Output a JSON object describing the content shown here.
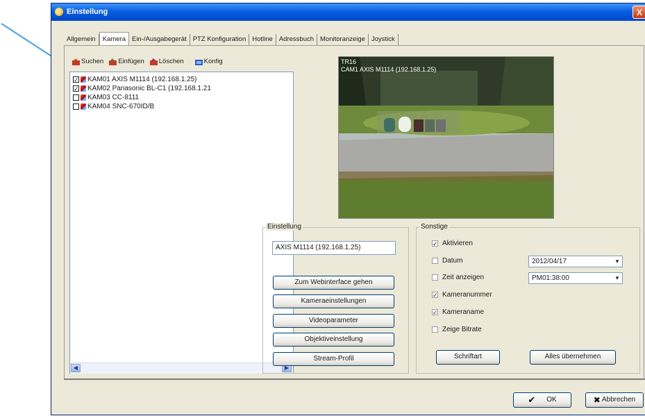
{
  "window": {
    "title": "Einstellung",
    "close_label": "X"
  },
  "tabs": [
    "Allgemein",
    "Kamera",
    "Ein-/Ausgabegerät",
    "PTZ Konfiguration",
    "Hotline",
    "Adressbuch",
    "Monitoranzeige",
    "Joystick"
  ],
  "toolbar": {
    "search": "Suchen",
    "insert": "Einfügen",
    "delete": "Löschen",
    "config": "Konfig"
  },
  "cameras": [
    {
      "label": "KAM01 AXIS M1114 (192.168.1.25)",
      "checked": true
    },
    {
      "label": "KAM02 Panasonic BL-C1 (192.168.1.21",
      "checked": true
    },
    {
      "label": "KAM03 CC-8111",
      "checked": false
    },
    {
      "label": "KAM04 SNC-670ID/B",
      "checked": false
    }
  ],
  "preview": {
    "overlay1": "TR16",
    "overlay2": "CAM1 AXIS M1114 (192.168.1.25)"
  },
  "settings_group": {
    "title": "Einstellung",
    "name_value": "AXIS M1114 (192.168.1.25)",
    "buttons": [
      "Zum Webinterface gehen",
      "Kameraeinstellungen",
      "Videoparameter",
      "Objektiveinstellung",
      "Stream-Profil"
    ]
  },
  "other_group": {
    "title": "Sonstige",
    "options": [
      {
        "label": "Aktivieren",
        "checked": true
      },
      {
        "label": "Datum",
        "checked": false
      },
      {
        "label": "Zeit anzeigen",
        "checked": false
      },
      {
        "label": "Kameranummer",
        "checked": true
      },
      {
        "label": "Kameraname",
        "checked": true
      },
      {
        "label": "Zeige Bitrate",
        "checked": false
      }
    ],
    "date_value": "2012/04/17",
    "time_value": "PM01:38:00",
    "font_button": "Schriftart",
    "apply_all_button": "Alles übernehmen"
  },
  "dialog": {
    "ok": "OK",
    "cancel": "Abbrechen"
  },
  "colors": {
    "titlebar": "#0a5ee0",
    "window_bg": "#ece9d8",
    "annotation_arrow": "#4aa3df"
  }
}
